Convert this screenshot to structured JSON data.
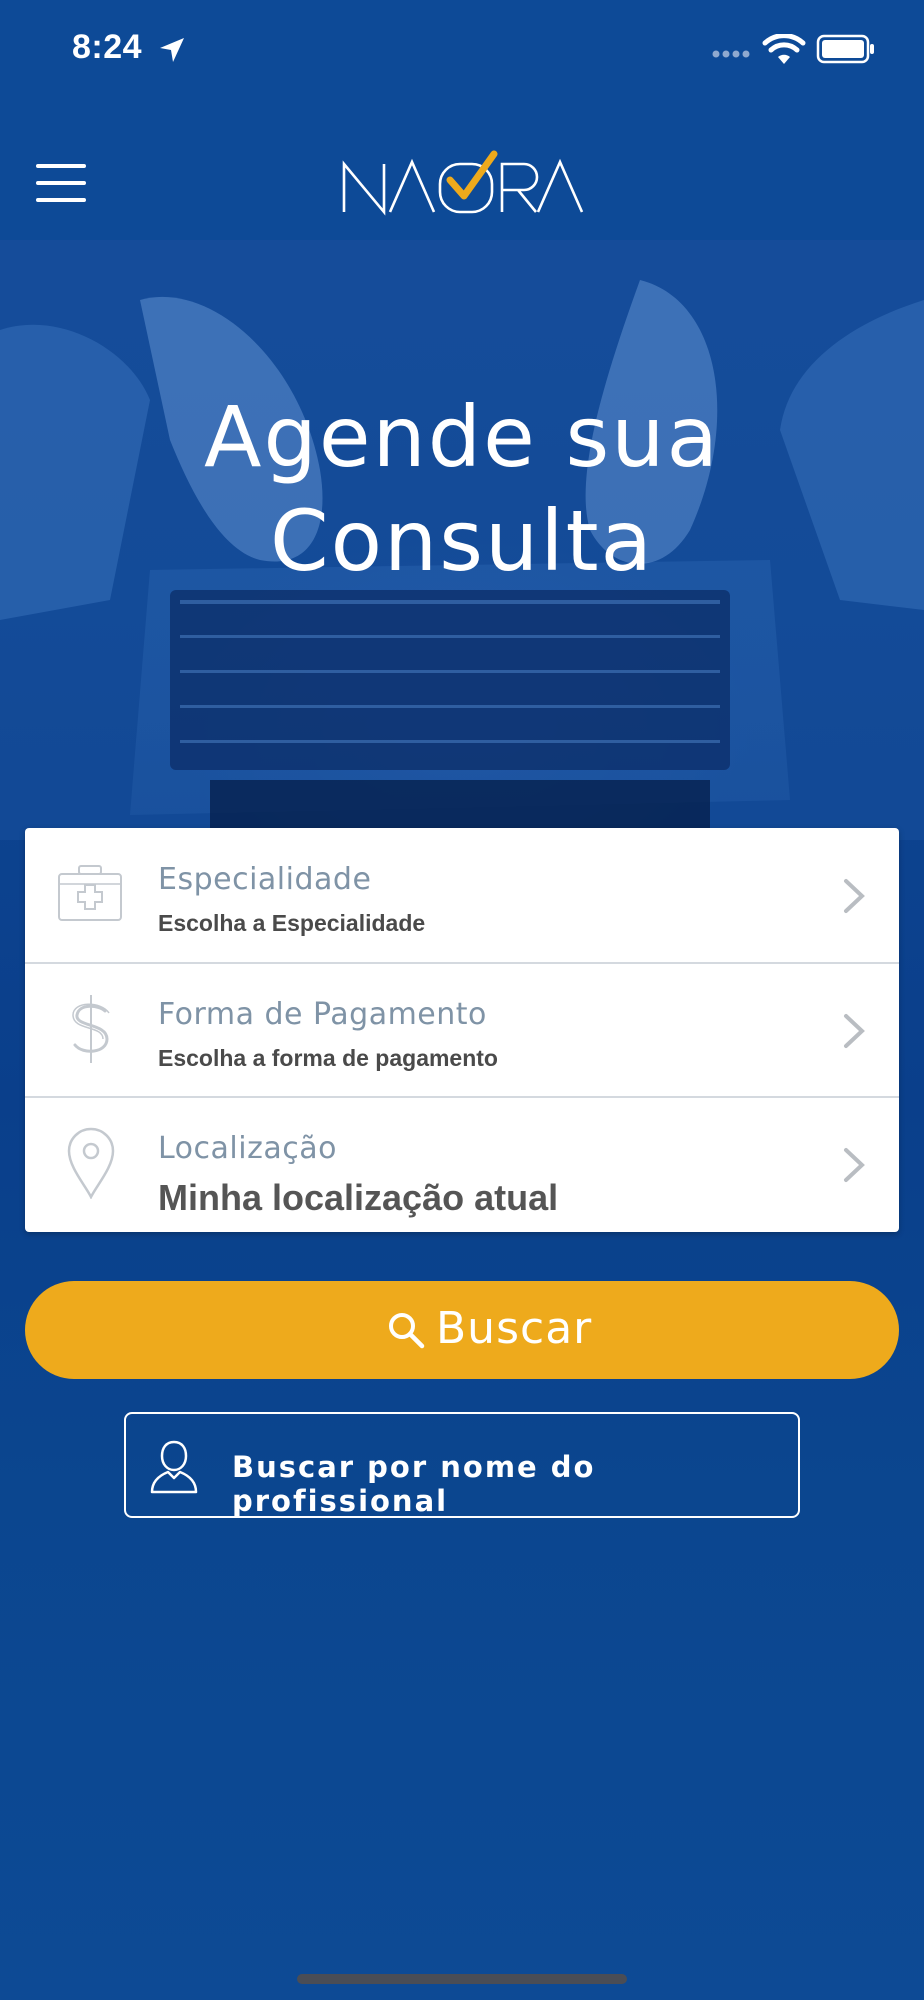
{
  "status_bar": {
    "time": "8:24",
    "icons": [
      "location-arrow-icon",
      "signal-dots-icon",
      "wifi-icon",
      "battery-icon"
    ]
  },
  "navbar": {
    "logo_text": "NAORA",
    "icons": [
      "hamburger-menu-icon"
    ]
  },
  "hero": {
    "title_line1": "Agende sua",
    "title_line2": "Consulta"
  },
  "form": {
    "rows": [
      {
        "icon": "medical-kit-icon",
        "label": "Especialidade",
        "value": "Escolha a Especialidade"
      },
      {
        "icon": "dollar-icon",
        "label": "Forma de Pagamento",
        "value": "Escolha a forma de pagamento"
      },
      {
        "icon": "location-pin-icon",
        "label": "Localização",
        "value": "Minha localização atual"
      }
    ]
  },
  "buttons": {
    "search_label": "Buscar",
    "professional_label": "Buscar por nome do profissional"
  },
  "colors": {
    "primary_blue": "#0d4a97",
    "accent_yellow": "#eeaa1c",
    "label_gray": "#7f93a6"
  }
}
